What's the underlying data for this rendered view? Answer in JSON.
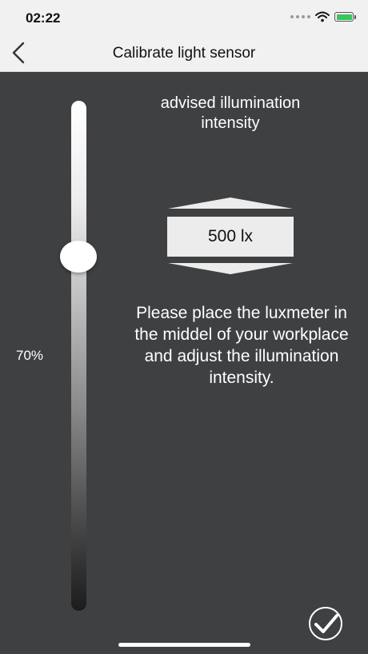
{
  "status_bar": {
    "time": "02:22"
  },
  "nav": {
    "title": "Calibrate light sensor"
  },
  "slider": {
    "level_percent": 70,
    "label": "70%"
  },
  "advised": {
    "label": "advised illumination intensity",
    "value": "500 lx"
  },
  "instructions": {
    "text": "Please place the luxmeter in the middel of your workplace and adjust the illumination intensity."
  },
  "colors": {
    "background": "#3f4042",
    "bar": "#f1f1f1",
    "text_light": "#ffffff",
    "value_box": "#ececec"
  },
  "icons": {
    "back": "chevron-left-icon",
    "confirm": "checkmark-icon",
    "increase": "triangle-up-icon",
    "decrease": "triangle-down-icon"
  }
}
